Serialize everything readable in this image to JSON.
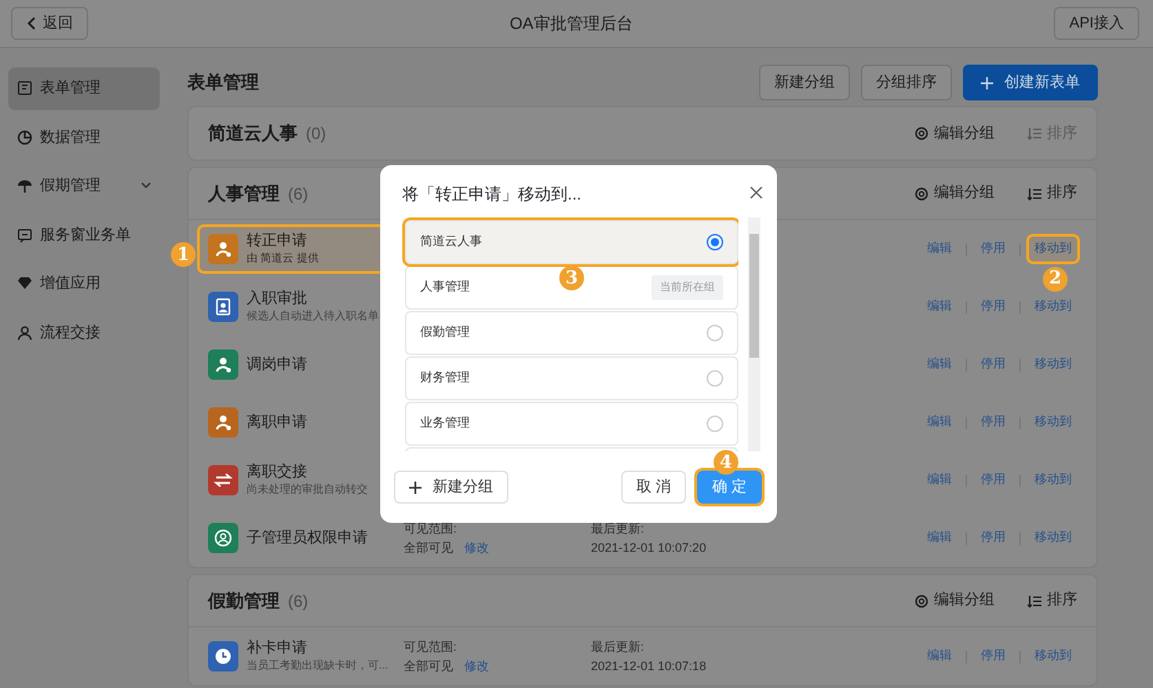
{
  "header": {
    "back": "返回",
    "title": "OA审批管理后台",
    "api_button": "API接入"
  },
  "sidebar": {
    "items": [
      {
        "label": "表单管理",
        "selected": true
      },
      {
        "label": "数据管理",
        "selected": false
      },
      {
        "label": "假期管理",
        "selected": false,
        "expandable": true
      },
      {
        "label": "服务窗业务单",
        "selected": false
      },
      {
        "label": "增值应用",
        "selected": false
      },
      {
        "label": "流程交接",
        "selected": false
      }
    ]
  },
  "main": {
    "title": "表单管理",
    "buttons": [
      {
        "label": "新建分组",
        "primary": false
      },
      {
        "label": "分组排序",
        "primary": false
      },
      {
        "label": "创建新表单",
        "primary": true
      }
    ],
    "groups": [
      {
        "name": "简道云人事",
        "count": "(0)",
        "edit": "编辑分组",
        "sort": "排序",
        "sort_disabled": true
      },
      {
        "name": "人事管理",
        "count": "(6)",
        "edit": "编辑分组",
        "sort": "排序",
        "sort_disabled": false,
        "forms": [
          {
            "name": "转正申请",
            "desc": "由 简道云 提供",
            "kind": "person",
            "color": "#c4731f",
            "marker": "1",
            "actions": [
              "编辑",
              "停用",
              "移动到"
            ],
            "action_marker": "2"
          },
          {
            "name": "入职审批",
            "desc": "候选人自动进入待入职名单",
            "kind": "card",
            "color": "#2f62b0",
            "actions": [
              "编辑",
              "停用",
              "移动到"
            ]
          },
          {
            "name": "调岗申请",
            "kind": "person",
            "color": "#1e7f58",
            "actions": [
              "编辑",
              "停用",
              "移动到"
            ]
          },
          {
            "name": "离职申请",
            "kind": "person",
            "color": "#b8651f",
            "actions": [
              "编辑",
              "停用",
              "移动到"
            ]
          },
          {
            "name": "离职交接",
            "desc": "尚未处理的审批自动转交",
            "kind": "exchange",
            "color": "#b2392e",
            "actions": [
              "编辑",
              "停用",
              "移动到"
            ]
          },
          {
            "name": "子管理员权限申请",
            "kind": "ring",
            "color": "#1e7f58",
            "visibility_label": "可见范围:",
            "visibility": "全部可见",
            "modify": "修改",
            "updated_label": "最后更新:",
            "updated": "2021-12-01 10:07:20",
            "actions": [
              "编辑",
              "停用",
              "移动到"
            ]
          }
        ]
      },
      {
        "name": "假勤管理",
        "count": "(6)",
        "edit": "编辑分组",
        "sort": "排序",
        "sort_disabled": false,
        "forms": [
          {
            "name": "补卡申请",
            "desc": "当员工考勤出现缺卡时，可...",
            "kind": "clock",
            "color": "#2f62b0",
            "visibility_label": "可见范围:",
            "visibility": "全部可见",
            "modify": "修改",
            "updated_label": "最后更新:",
            "updated": "2021-12-01 10:07:18",
            "actions": [
              "编辑",
              "停用",
              "移动到"
            ]
          }
        ]
      }
    ]
  },
  "dialog": {
    "title": "将「转正申请」移动到...",
    "options": [
      {
        "label": "简道云人事",
        "kind": "radio",
        "selected": true,
        "marker": "3"
      },
      {
        "label": "人事管理",
        "kind": "current",
        "tag": "当前所在组",
        "selected": false
      },
      {
        "label": "假勤管理",
        "kind": "radio",
        "selected": false
      },
      {
        "label": "财务管理",
        "kind": "radio",
        "selected": false
      },
      {
        "label": "业务管理",
        "kind": "radio",
        "selected": false
      },
      {
        "kind": "partial"
      }
    ],
    "new_group": "新建分组",
    "cancel": "取 消",
    "confirm": "确 定",
    "confirm_marker": "4"
  }
}
